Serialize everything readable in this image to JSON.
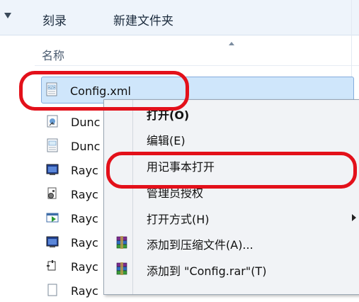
{
  "toolbar": {
    "burn_label": "刻录",
    "new_folder_label": "新建文件夹"
  },
  "header": {
    "name_label": "名称"
  },
  "files": [
    {
      "label": "Config.xml",
      "icon": "xml-file-icon"
    },
    {
      "label": "Dunc",
      "icon": "shortcut-file-icon"
    },
    {
      "label": "Dunc",
      "icon": "xml-file-icon"
    },
    {
      "label": "Rayc",
      "icon": "application-icon"
    },
    {
      "label": "Rayc",
      "icon": "component-icon"
    },
    {
      "label": "Rayc",
      "icon": "launcher-icon"
    },
    {
      "label": "Rayc",
      "icon": "application-icon"
    },
    {
      "label": "Rayc",
      "icon": "plugin-icon"
    },
    {
      "label": "Rayc",
      "icon": "file-icon"
    }
  ],
  "context_menu": {
    "items": [
      {
        "label": "打开(O)",
        "bold": true
      },
      {
        "label": "编辑(E)"
      },
      {
        "label": "用记事本打开"
      },
      {
        "label": "管理员授权"
      },
      {
        "label": "打开方式(H)",
        "has_submenu": true
      },
      {
        "label": "添加到压缩文件(A)...",
        "icon": "winrar-icon"
      },
      {
        "label": "添加到 \"Config.rar\"(T)",
        "icon": "winrar-icon"
      }
    ]
  },
  "colors": {
    "highlight_red": "#e3101a",
    "selection_blue": "#cfe6fb",
    "toolbar_bg": "#eef4fb"
  }
}
